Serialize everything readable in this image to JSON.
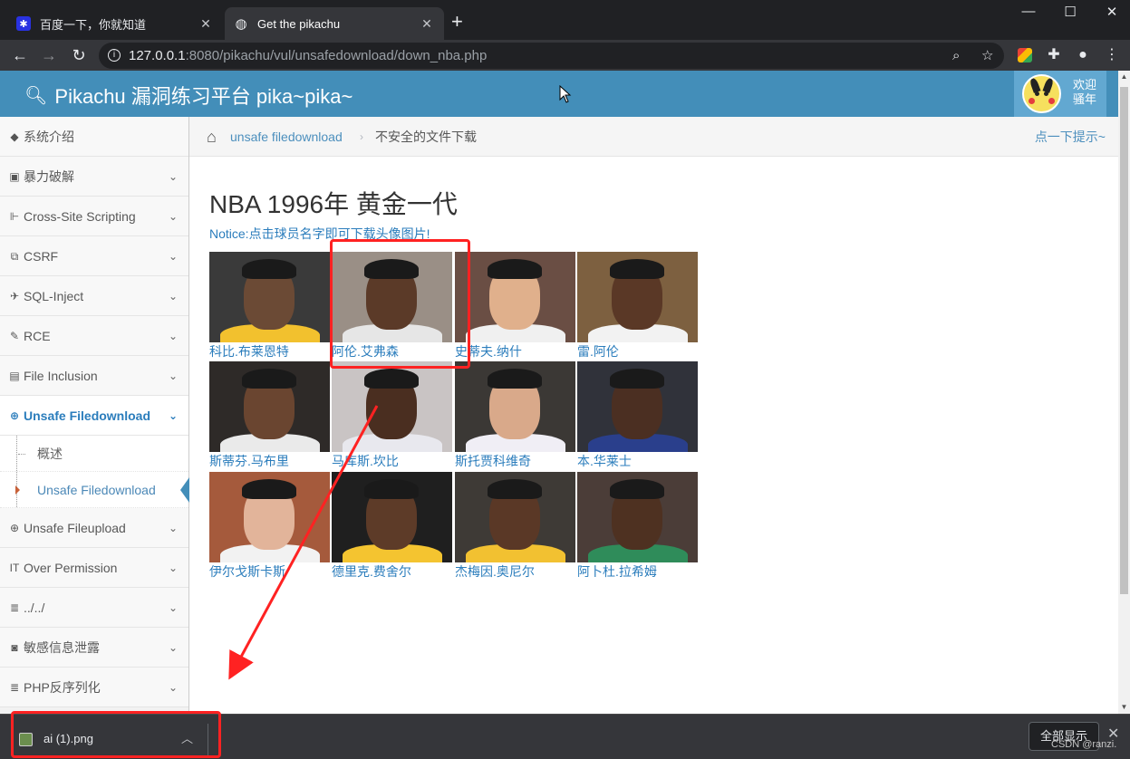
{
  "browser": {
    "tabs": [
      {
        "title": "百度一下，你就知道",
        "favicon": "baidu-paw-icon",
        "active": false
      },
      {
        "title": "Get the pikachu",
        "favicon": "globe-icon",
        "active": true
      }
    ],
    "new_tab_symbol": "+",
    "url_host": "127.0.0.1",
    "url_rest": ":8080/pikachu/vul/unsafedownload/down_nba.php"
  },
  "header": {
    "brand": "Pikachu 漏洞练习平台 pika~pika~",
    "welcome_line1": "欢迎",
    "welcome_line2": "骚年"
  },
  "sidebar": {
    "items": [
      {
        "label": "系统介绍",
        "icon": "tag-icon",
        "has_children": false
      },
      {
        "label": "暴力破解",
        "icon": "lock-icon",
        "has_children": true
      },
      {
        "label": "Cross-Site Scripting",
        "icon": "sitemap-icon",
        "has_children": true
      },
      {
        "label": "CSRF",
        "icon": "external-link-icon",
        "has_children": true
      },
      {
        "label": "SQL-Inject",
        "icon": "plane-icon",
        "has_children": true
      },
      {
        "label": "RCE",
        "icon": "pencil-icon",
        "has_children": true
      },
      {
        "label": "File Inclusion",
        "icon": "file-icon",
        "has_children": true
      },
      {
        "label": "Unsafe Filedownload",
        "icon": "download-icon",
        "has_children": true,
        "open": true
      },
      {
        "label": "Unsafe Fileupload",
        "icon": "upload-icon",
        "has_children": true
      },
      {
        "label": "Over Permission",
        "icon": "text-height-icon",
        "has_children": true
      },
      {
        "label": "../../",
        "icon": "list-icon",
        "has_children": true
      },
      {
        "label": "敏感信息泄露",
        "icon": "camera-icon",
        "has_children": true
      },
      {
        "label": "PHP反序列化",
        "icon": "list-icon",
        "has_children": true
      }
    ],
    "sub_items": [
      {
        "label": "概述",
        "active": false
      },
      {
        "label": "Unsafe Filedownload",
        "active": true
      }
    ]
  },
  "breadcrumbs": {
    "section": "unsafe filedownload",
    "current": "不安全的文件下载",
    "tips": "点一下提示~"
  },
  "main": {
    "title": "NBA 1996年 黄金一代",
    "notice": "Notice:点击球员名字即可下载头像图片!",
    "players": [
      {
        "name": "科比.布莱恩特",
        "skin": "#6b4a35",
        "jersey": "#f2c12e",
        "bg": "#3a3a3a"
      },
      {
        "name": "阿伦.艾弗森",
        "skin": "#5b3a28",
        "jersey": "#e6e6e6",
        "bg": "#9a8f86"
      },
      {
        "name": "史蒂夫.纳什",
        "skin": "#e0b08c",
        "jersey": "#f0f0f0",
        "bg": "#6a4e44"
      },
      {
        "name": "雷.阿伦",
        "skin": "#5a3826",
        "jersey": "#f2f2f2",
        "bg": "#7d6040"
      },
      {
        "name": "斯蒂芬.马布里",
        "skin": "#6a4530",
        "jersey": "#eaeaea",
        "bg": "#2e2a28"
      },
      {
        "name": "马库斯.坎比",
        "skin": "#4a2e20",
        "jersey": "#e8e8ee",
        "bg": "#c9c4c4"
      },
      {
        "name": "斯托贾科维奇",
        "skin": "#d9a98a",
        "jersey": "#f0eef5",
        "bg": "#3b3835"
      },
      {
        "name": "本.华莱士",
        "skin": "#4b2f22",
        "jersey": "#2a3f8c",
        "bg": "#30323a"
      },
      {
        "name": "伊尔戈斯卡斯",
        "skin": "#e2b49a",
        "jersey": "#f2f2f2",
        "bg": "#a55a3c"
      },
      {
        "name": "德里克.费舍尔",
        "skin": "#5d3b28",
        "jersey": "#f4c430",
        "bg": "#1f1f1f"
      },
      {
        "name": "杰梅因.奥尼尔",
        "skin": "#5a3826",
        "jersey": "#f2c131",
        "bg": "#3e3a36"
      },
      {
        "name": "阿卜杜.拉希姆",
        "skin": "#4e3121",
        "jersey": "#2f8c5a",
        "bg": "#4b3d38"
      }
    ]
  },
  "download_shelf": {
    "filename": "ai (1).png",
    "show_all": "全部显示",
    "watermark": "CSDN @ranzi."
  }
}
